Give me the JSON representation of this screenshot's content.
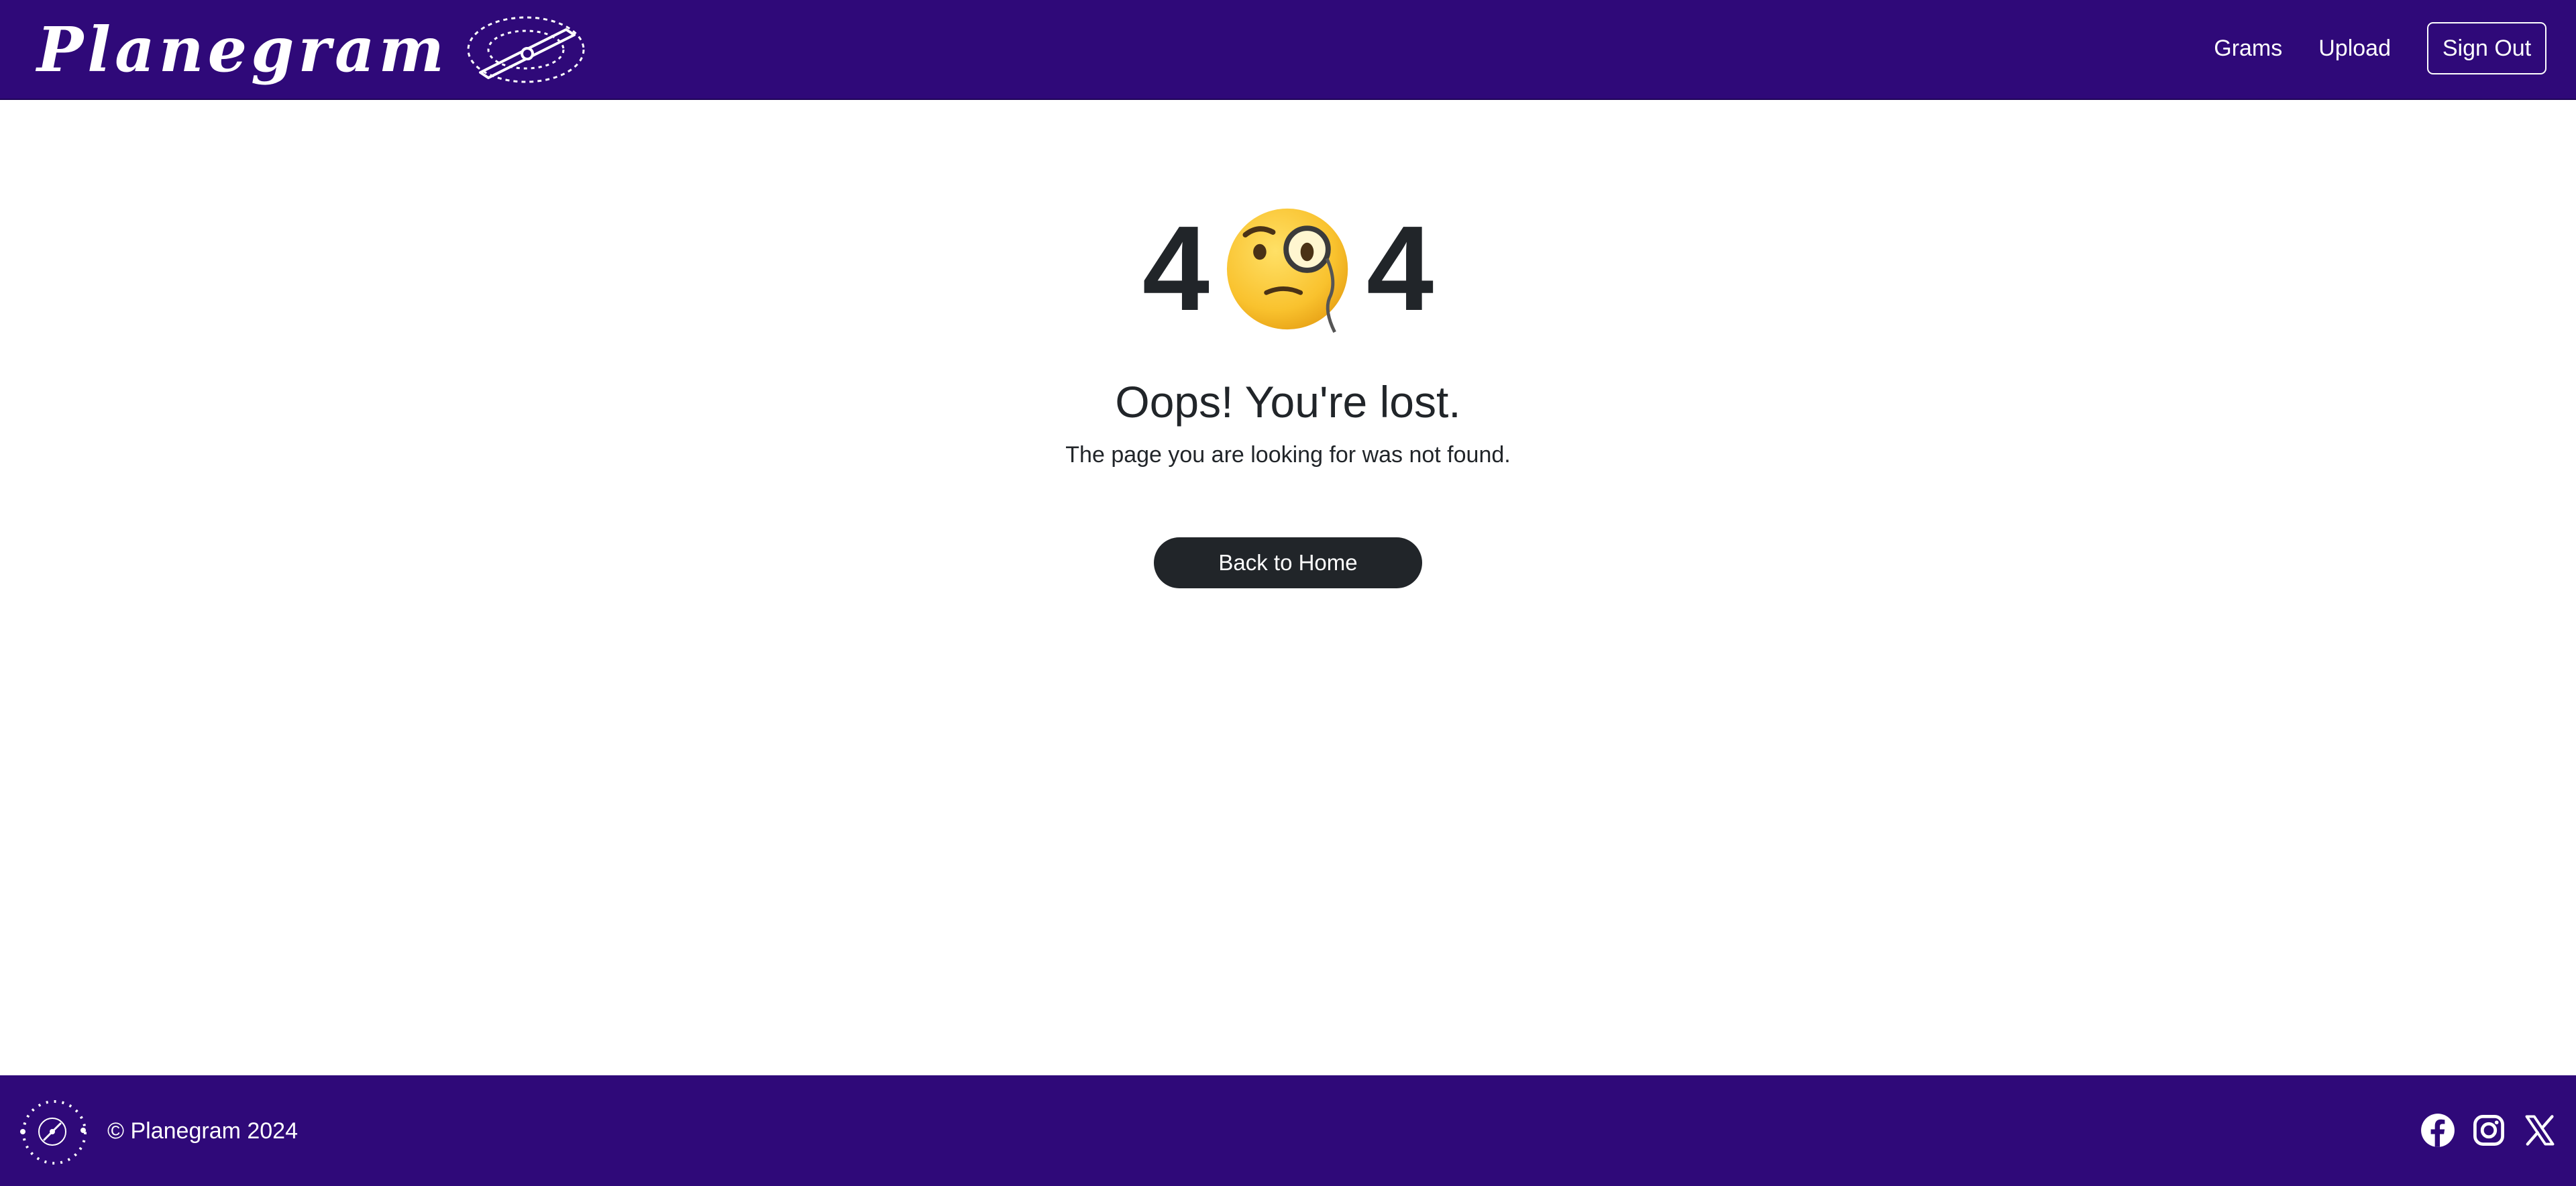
{
  "header": {
    "brand": "Planegram",
    "nav": [
      {
        "label": "Grams"
      },
      {
        "label": "Upload"
      }
    ],
    "sign_out_label": "Sign Out"
  },
  "error_page": {
    "code_left": "4",
    "code_emoji": "face-with-monocle-emoji",
    "code_right": "4",
    "title": "Oops! You're lost.",
    "message": "The page you are looking for was not found.",
    "home_button_label": "Back to Home"
  },
  "footer": {
    "copyright": "© Planegram 2024",
    "social_icons": [
      "facebook-icon",
      "instagram-icon",
      "x-icon"
    ]
  },
  "colors": {
    "brand_purple": "#2f0979",
    "text_dark": "#212529",
    "button_dark": "#212529",
    "white": "#ffffff"
  }
}
